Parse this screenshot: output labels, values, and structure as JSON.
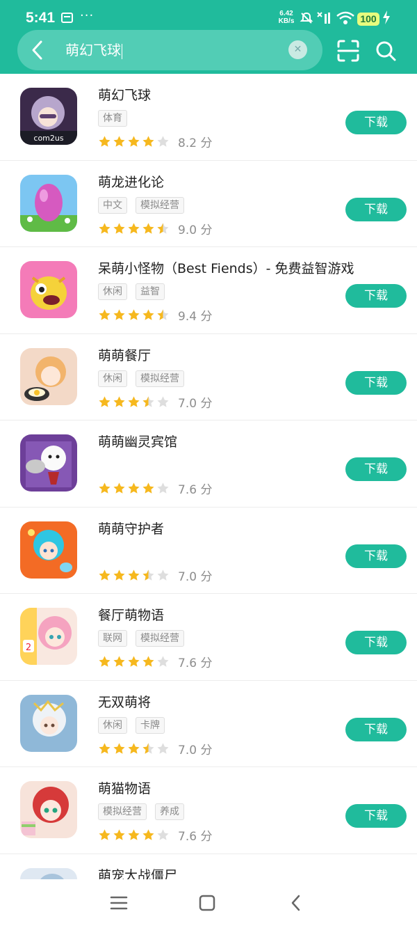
{
  "status_bar": {
    "time": "5:41",
    "dots": "···",
    "speed_value": "6.42",
    "speed_unit": "KB/s",
    "battery": "100"
  },
  "search": {
    "query": "萌幻飞球"
  },
  "colors": {
    "accent": "#20bb9c",
    "star": "#f6b81e",
    "star_empty": "#dedede"
  },
  "apps": [
    {
      "name": "萌幻飞球",
      "tags": [
        "体育"
      ],
      "rating": 4,
      "score": "8.2 分",
      "button": "下载",
      "icon": "purple-hair-character"
    },
    {
      "name": "萌龙进化论",
      "tags": [
        "中文",
        "模拟经营"
      ],
      "rating": 4.5,
      "score": "9.0 分",
      "button": "下载",
      "icon": "pink-egg"
    },
    {
      "name": "呆萌小怪物（Best Fiends）- 免费益智游戏",
      "tags": [
        "休闲",
        "益智"
      ],
      "rating": 4.5,
      "score": "9.4 分",
      "button": "下载",
      "icon": "yellow-monster"
    },
    {
      "name": "萌萌餐厅",
      "tags": [
        "休闲",
        "模拟经营"
      ],
      "rating": 3.5,
      "score": "7.0 分",
      "button": "下载",
      "icon": "chef-girl"
    },
    {
      "name": "萌萌幽灵宾馆",
      "tags": [],
      "rating": 4,
      "score": "7.6 分",
      "button": "下载",
      "icon": "ghost-waiter"
    },
    {
      "name": "萌萌守护者",
      "tags": [],
      "rating": 3.5,
      "score": "7.0 分",
      "button": "下载",
      "icon": "blue-hair-hero"
    },
    {
      "name": "餐厅萌物语",
      "tags": [
        "联网",
        "模拟经营"
      ],
      "rating": 4,
      "score": "7.6 分",
      "button": "下载",
      "icon": "pink-hair-girl"
    },
    {
      "name": "无双萌将",
      "tags": [
        "休闲",
        "卡牌"
      ],
      "rating": 3.5,
      "score": "7.0 分",
      "button": "下载",
      "icon": "white-hair-warrior"
    },
    {
      "name": "萌猫物语",
      "tags": [
        "模拟经营",
        "养成"
      ],
      "rating": 4,
      "score": "7.6 分",
      "button": "下载",
      "icon": "red-hair-girl"
    },
    {
      "name": "萌宠大战僵尸",
      "tags": [],
      "rating": null,
      "score": "",
      "button": "",
      "icon": "partial-icon"
    }
  ],
  "nav": {
    "items": [
      "menu-icon",
      "home-icon",
      "back-icon"
    ]
  }
}
